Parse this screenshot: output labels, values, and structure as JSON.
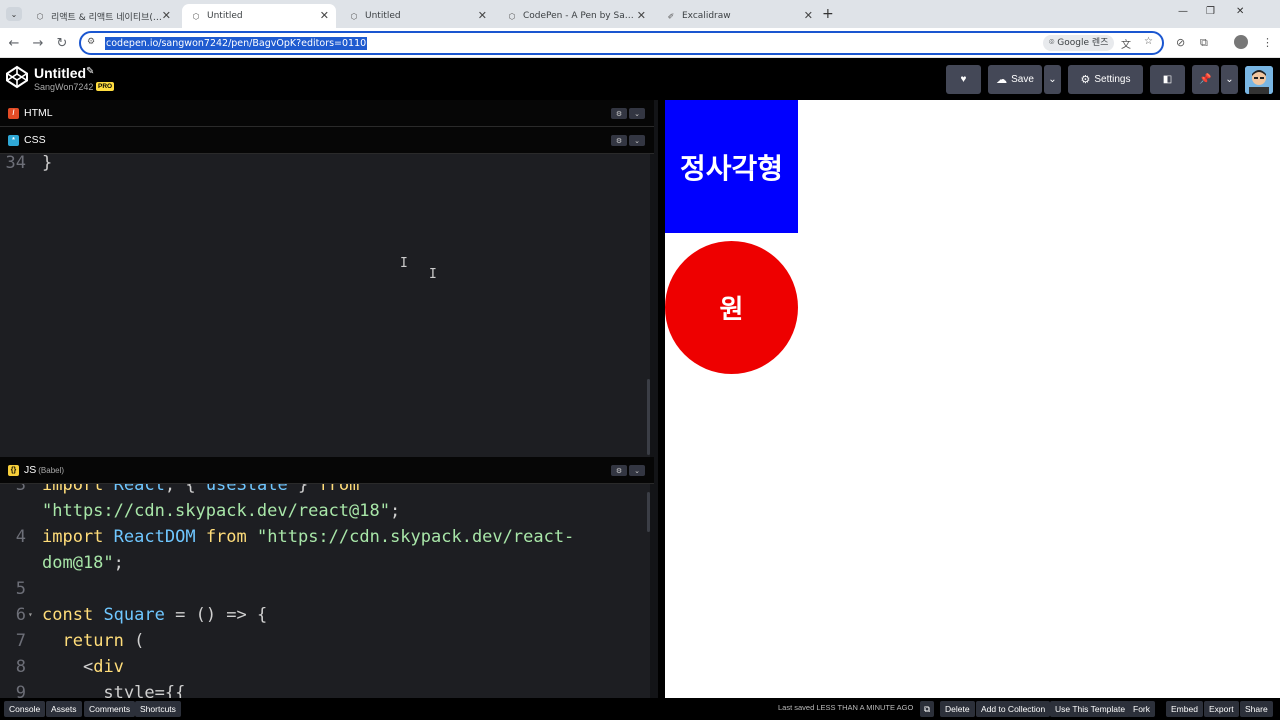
{
  "browser": {
    "tabs": [
      {
        "title": "리액트 & 리액트 네이티브(인프",
        "icon": "codepen-icon"
      },
      {
        "title": "Untitled",
        "icon": "codepen-icon"
      },
      {
        "title": "Untitled",
        "icon": "codepen-icon"
      },
      {
        "title": "CodePen - A Pen by SangWon",
        "icon": "codepen-icon"
      },
      {
        "title": "Excalidraw",
        "icon": "excalidraw-icon"
      }
    ],
    "active_tab": 1,
    "url": "codepen.io/sangwon7242/pen/BagvOpK?editors=0110",
    "lens_label": "Google 렌즈",
    "new_tab": "+",
    "minimize": "—",
    "restore": "❐",
    "close": "✕"
  },
  "codepen": {
    "title": "Untitled",
    "username": "SangWon7242",
    "pro_badge": "PRO",
    "buttons": {
      "like": "♥",
      "save": "Save",
      "settings": "Settings"
    }
  },
  "editors": {
    "html": {
      "label": "HTML",
      "color": "#e34c26"
    },
    "css": {
      "label": "CSS",
      "color": "#2fa8d6",
      "lines": [
        {
          "n": "34",
          "text": "}"
        }
      ]
    },
    "js": {
      "label": "JS",
      "sublabel": "(Babel)",
      "color": "#f7cf3b",
      "lines": [
        {
          "n": "3",
          "html": "<span class=\"k\">import</span> <span class=\"v\">React</span><span class=\"o\">, { </span><span class=\"v\">useState</span><span class=\"o\"> } </span><span class=\"k\">from</span>"
        },
        {
          "n": "",
          "html": "<span class=\"s\">\"https://cdn.skypack.dev/react@18\"</span><span class=\"o\">;</span>"
        },
        {
          "n": "4",
          "html": "<span class=\"k\">import</span> <span class=\"v\">ReactDOM</span> <span class=\"k\">from</span> <span class=\"s\">\"https://cdn.skypack.dev/react-</span>"
        },
        {
          "n": "",
          "html": "<span class=\"s\">dom@18\"</span><span class=\"o\">;</span>"
        },
        {
          "n": "5",
          "html": ""
        },
        {
          "n": "6",
          "html": "<span class=\"k\">const</span> <span class=\"v\">Square</span> <span class=\"o\">= () =&gt; {</span>"
        },
        {
          "n": "7",
          "html": "  <span class=\"k\">return</span> <span class=\"o\">(</span>"
        },
        {
          "n": "8",
          "html": "    <span class=\"o\">&lt;</span><span class=\"k\">div</span>"
        },
        {
          "n": "9",
          "html": "      <span class=\"o\">style={{</span>"
        }
      ]
    }
  },
  "preview": {
    "square_text": "정사각형",
    "circle_text": "원",
    "square_color": "#0000ff",
    "circle_color": "#ee0000"
  },
  "footer": {
    "left": [
      "Console",
      "Assets",
      "Comments",
      "Shortcuts"
    ],
    "last_saved": "Last saved LESS THAN A MINUTE AGO",
    "right": [
      "Delete",
      "Add to Collection",
      "Use This Template",
      "Fork",
      "Embed",
      "Export",
      "Share"
    ]
  }
}
